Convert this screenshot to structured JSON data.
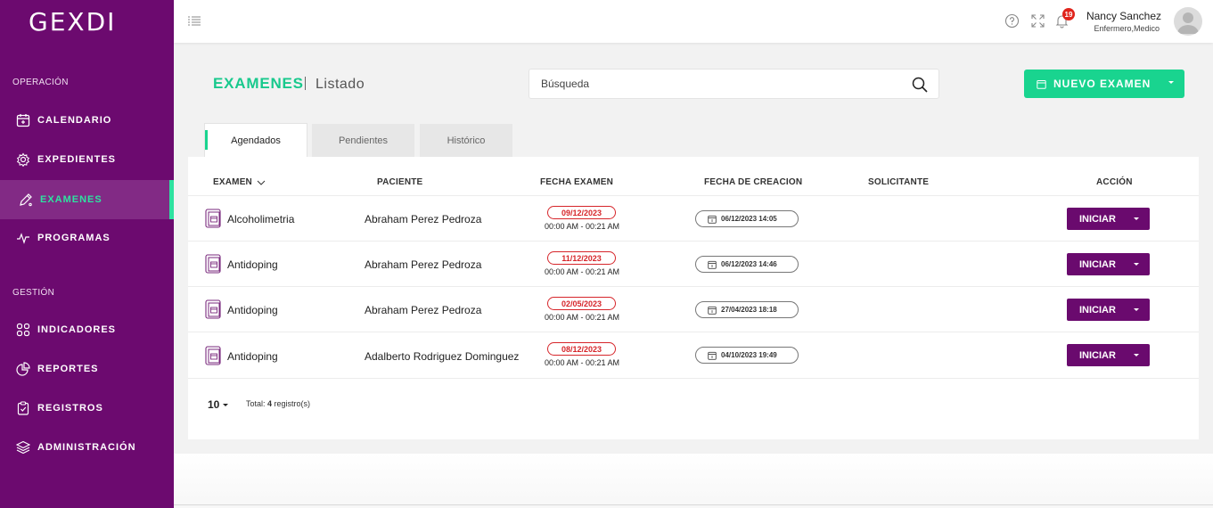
{
  "app": {
    "logo": "GEXDI"
  },
  "sidebar": {
    "sections": [
      {
        "label": "OPERACIÓN"
      },
      {
        "label": "GESTIÓN"
      }
    ],
    "items": [
      {
        "label": "CALENDARIO",
        "icon": "calendar-icon"
      },
      {
        "label": "EXPEDIENTES",
        "icon": "gear-icon"
      },
      {
        "label": "EXAMENES",
        "icon": "pencil-icon",
        "active": true
      },
      {
        "label": "PROGRAMAS",
        "icon": "pulse-icon"
      },
      {
        "label": "INDICADORES",
        "icon": "grid-icon"
      },
      {
        "label": "REPORTES",
        "icon": "pie-icon"
      },
      {
        "label": "REGISTROS",
        "icon": "clipboard-icon"
      },
      {
        "label": "ADMINISTRACIÓN",
        "icon": "layers-icon"
      }
    ]
  },
  "topbar": {
    "notifications_count": "19",
    "user_name": "Nancy Sanchez",
    "user_role": "Enfermero,Medico"
  },
  "header": {
    "title": "EXAMENES",
    "subtitle": "Listado",
    "search_placeholder": "Búsqueda",
    "new_button": "NUEVO EXAMEN"
  },
  "tabs": [
    {
      "label": "Agendados",
      "active": true
    },
    {
      "label": "Pendientes"
    },
    {
      "label": "Histórico"
    }
  ],
  "table": {
    "columns": [
      "EXAMEN",
      "PACIENTE",
      "FECHA EXAMEN",
      "FECHA DE CREACION",
      "SOLICITANTE",
      "ACCIÓN"
    ],
    "rows": [
      {
        "exam": "Alcoholimetria",
        "patient": "Abraham Perez Pedroza",
        "date": "09/12/2023",
        "time": "00:00 AM - 00:21 AM",
        "created": "06/12/2023 14:05",
        "requester": "",
        "action": "INICIAR"
      },
      {
        "exam": "Antidoping",
        "patient": "Abraham Perez Pedroza",
        "date": "11/12/2023",
        "time": "00:00 AM - 00:21 AM",
        "created": "06/12/2023 14:46",
        "requester": "",
        "action": "INICIAR"
      },
      {
        "exam": "Antidoping",
        "patient": "Abraham Perez Pedroza",
        "date": "02/05/2023",
        "time": "00:00 AM - 00:21 AM",
        "created": "27/04/2023 18:18",
        "requester": "",
        "action": "INICIAR"
      },
      {
        "exam": "Antidoping",
        "patient": "Adalberto Rodriguez Dominguez",
        "date": "08/12/2023",
        "time": "00:00 AM - 00:21 AM",
        "created": "04/10/2023 19:49",
        "requester": "",
        "action": "INICIAR"
      }
    ]
  },
  "pagination": {
    "page_size": "10",
    "total_prefix": "Total: ",
    "total_count": "4",
    "total_suffix": " registro(s)"
  },
  "colors": {
    "sidebar": "#6c0a6f",
    "accent": "#19d48f",
    "date_red": "#d6252a",
    "action_purple": "#6a0a6e"
  }
}
